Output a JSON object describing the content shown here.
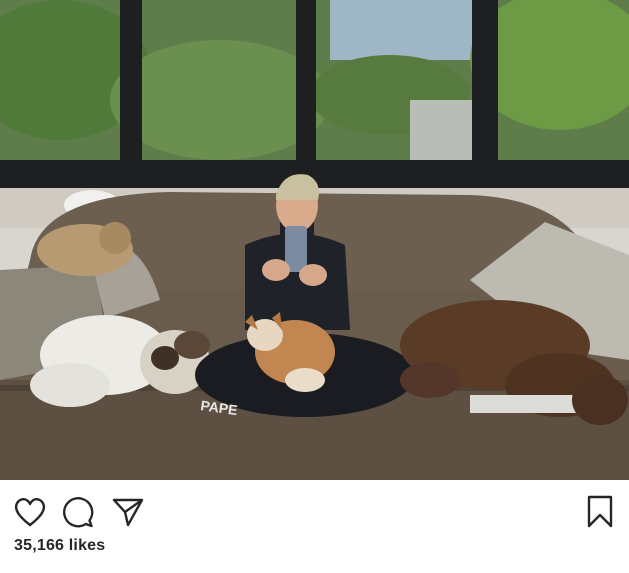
{
  "post": {
    "image_alt": "",
    "likes_text": "35,166 likes",
    "caption_user": "",
    "caption_text": ""
  },
  "actions": {
    "like_icon": "heart-outline-icon",
    "comment_icon": "comment-bubble-icon",
    "share_icon": "paper-plane-icon",
    "save_icon": "bookmark-outline-icon"
  },
  "colors": {
    "icon_stroke": "#262626",
    "text": "#262626",
    "background": "#ffffff"
  }
}
